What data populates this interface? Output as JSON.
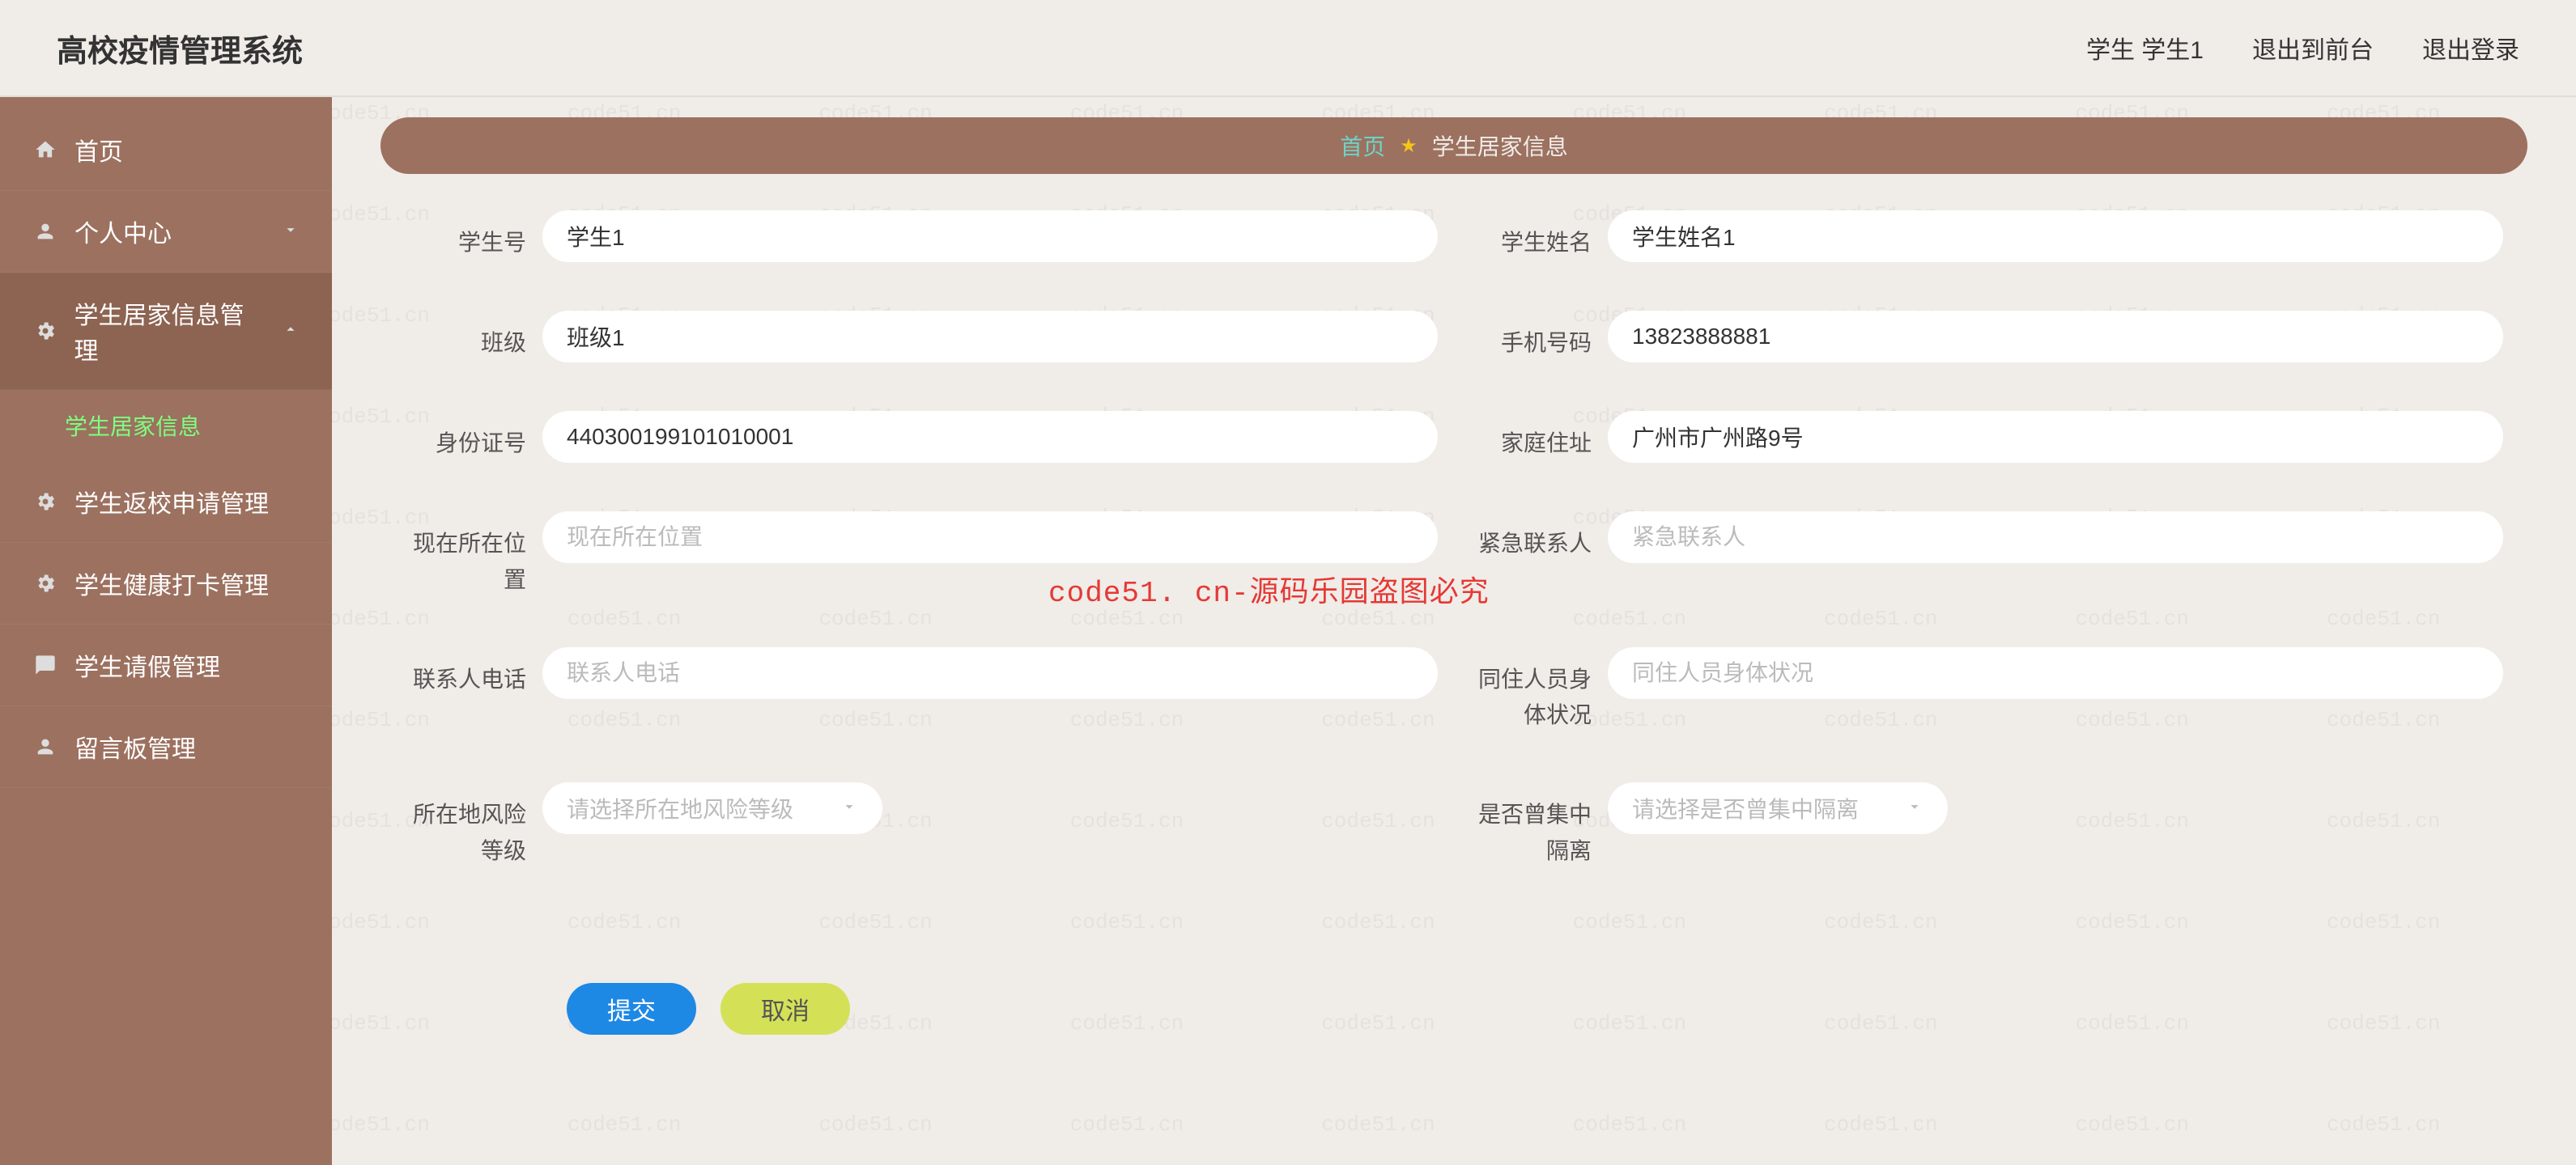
{
  "watermark": "code51.cn",
  "overlay_watermark": "code51. cn-源码乐园盗图必究",
  "header": {
    "title": "高校疫情管理系统",
    "user_label": "学生 学生1",
    "logout_front": "退出到前台",
    "logout": "退出登录"
  },
  "sidebar": {
    "items": [
      {
        "icon": "home",
        "label": "首页"
      },
      {
        "icon": "user",
        "label": "个人中心",
        "chevron": "down"
      },
      {
        "icon": "setting",
        "label": "学生居家信息管理",
        "chevron": "up",
        "expanded": true,
        "children": [
          {
            "label": "学生居家信息",
            "active": true
          }
        ]
      },
      {
        "icon": "setting",
        "label": "学生返校申请管理"
      },
      {
        "icon": "setting",
        "label": "学生健康打卡管理"
      },
      {
        "icon": "chat",
        "label": "学生请假管理"
      },
      {
        "icon": "user",
        "label": "留言板管理"
      }
    ]
  },
  "breadcrumb": {
    "home": "首页",
    "current": "学生居家信息"
  },
  "form": {
    "fields": {
      "student_id": {
        "label": "学生号",
        "value": "学生1"
      },
      "student_name": {
        "label": "学生姓名",
        "value": "学生姓名1"
      },
      "class_name": {
        "label": "班级",
        "value": "班级1"
      },
      "phone": {
        "label": "手机号码",
        "value": "13823888881"
      },
      "id_card": {
        "label": "身份证号",
        "value": "440300199101010001"
      },
      "home_address": {
        "label": "家庭住址",
        "value": "广州市广州路9号"
      },
      "current_location": {
        "label": "现在所在位置",
        "value": "",
        "placeholder": "现在所在位置"
      },
      "emergency_contact": {
        "label": "紧急联系人",
        "value": "",
        "placeholder": "紧急联系人"
      },
      "contact_phone": {
        "label": "联系人电话",
        "value": "",
        "placeholder": "联系人电话"
      },
      "cohabitant_health": {
        "label": "同住人员身体状况",
        "value": "",
        "placeholder": "同住人员身体状况"
      },
      "risk_level": {
        "label": "所在地风险等级",
        "placeholder": "请选择所在地风险等级"
      },
      "quarantine": {
        "label": "是否曾集中隔离",
        "placeholder": "请选择是否曾集中隔离"
      }
    },
    "buttons": {
      "submit": "提交",
      "cancel": "取消"
    }
  }
}
